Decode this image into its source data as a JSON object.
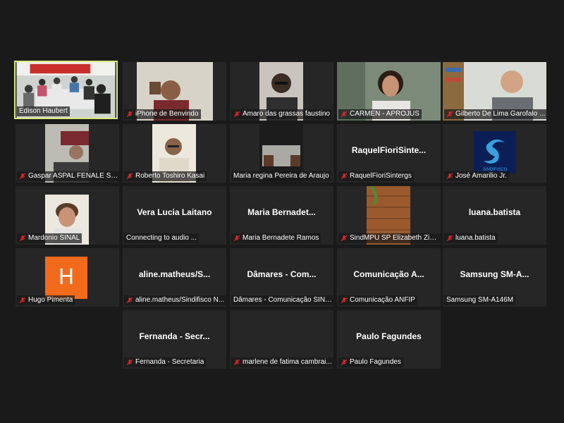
{
  "tiles": [
    {
      "name": "Edison Haubert",
      "center": "",
      "muted": false,
      "active": true
    },
    {
      "name": "iPhone de Benvindo",
      "center": "",
      "muted": true
    },
    {
      "name": "Amaro das grassas faustino",
      "center": "",
      "muted": true
    },
    {
      "name": "CARMEN - APROJUS",
      "center": "",
      "muted": true
    },
    {
      "name": "Gilberto De Lima Garofalo ...",
      "center": "",
      "muted": true
    },
    {
      "name": "Gaspar ASPAL FENALE SIN...",
      "center": "",
      "muted": true
    },
    {
      "name": "Roberto Toshiro Kasai",
      "center": "",
      "muted": true
    },
    {
      "name": "Maria regina Pereira de Araujo",
      "center": "",
      "muted": false
    },
    {
      "name": "RaquelFioriSintergs",
      "center": "RaquelFioriSinte...",
      "muted": true
    },
    {
      "name": "José Amarilio Jr.",
      "center": "",
      "muted": true,
      "logo_text": "SINDIFISCO"
    },
    {
      "name": "Mardonio SINAL",
      "center": "",
      "muted": true
    },
    {
      "name": "Connecting to audio ...",
      "center": "Vera Lucia Laitano",
      "muted": false
    },
    {
      "name": "Maria Bernadete Ramos",
      "center": "Maria  Bernadet...",
      "muted": true
    },
    {
      "name": "SindMPU SP Elizabeth Zim...",
      "center": "",
      "muted": true
    },
    {
      "name": "luana.batista",
      "center": "luana.batista",
      "muted": true
    },
    {
      "name": "Hugo Pimenta",
      "center": "",
      "muted": true,
      "avatar_letter": "H"
    },
    {
      "name": "aline.matheus/Sindifisco N...",
      "center": "aline.matheus/S...",
      "muted": true
    },
    {
      "name": "Dâmares - Comunicação SINAIT",
      "center": "Dâmares  -  Com...",
      "muted": false
    },
    {
      "name": "Comunicação ANFIP",
      "center": "Comunicação  A...",
      "muted": true
    },
    {
      "name": "Samsung SM-A146M",
      "center": "Samsung  SM-A...",
      "muted": false
    },
    {
      "name": "Fernanda - Secretaria",
      "center": "Fernanda  -  Secr...",
      "muted": true
    },
    {
      "name": "marlene de fatima cambrai...",
      "center": "",
      "muted": true
    },
    {
      "name": "Paulo Fagundes",
      "center": "Paulo Fagundes",
      "muted": true
    }
  ],
  "colors": {
    "mute": "#e02828",
    "active_border": "#d9e87a",
    "avatar": "#f26a1b"
  }
}
